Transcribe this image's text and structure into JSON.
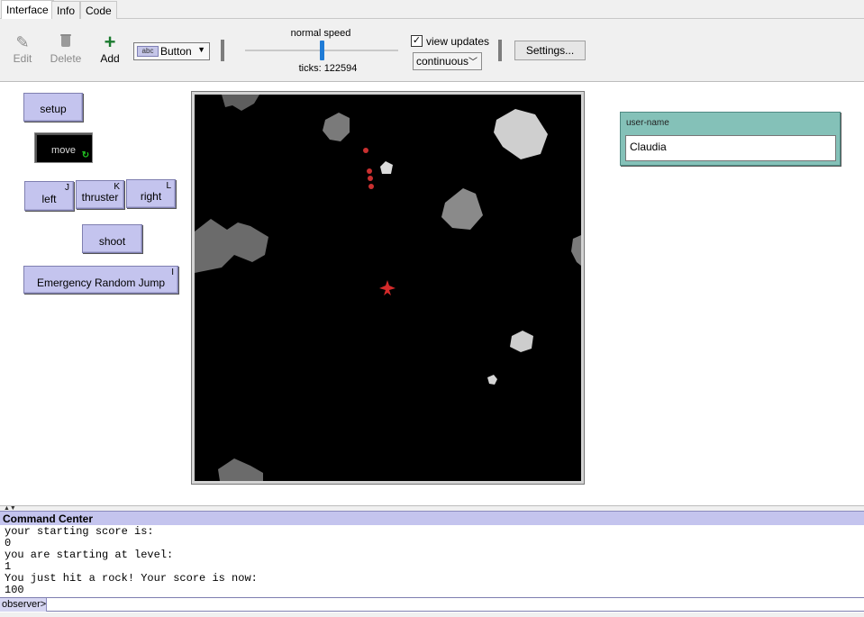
{
  "tabs": [
    "Interface",
    "Info",
    "Code"
  ],
  "toolbar": {
    "edit_label": "Edit",
    "delete_label": "Delete",
    "add_label": "Add",
    "widget_type": "Button",
    "widget_badge": "abc",
    "speed_label": "normal speed",
    "speed_value": 0.5,
    "ticks_text": "ticks: 122594",
    "view_updates_label": "view updates",
    "view_updates_checked": true,
    "update_mode": "continuous",
    "settings_label": "Settings..."
  },
  "buttons": {
    "setup": {
      "label": "setup"
    },
    "move": {
      "label": "move",
      "forever": true
    },
    "left": {
      "label": "left",
      "key": "J"
    },
    "thruster": {
      "label": "thruster",
      "key": "K"
    },
    "right": {
      "label": "right",
      "key": "L"
    },
    "shoot": {
      "label": "shoot"
    },
    "jump": {
      "label": "Emergency Random Jump",
      "key": "I"
    }
  },
  "input": {
    "label": "user-name",
    "value": "Claudia"
  },
  "command_center": {
    "title": "Command Center",
    "output": [
      "your starting score is:",
      "0",
      "you are starting at level:",
      "1",
      "You just hit a rock! Your score is now:",
      "100"
    ],
    "prompt": "observer>",
    "input_value": ""
  },
  "colors": {
    "button_bg": "#c4c4ee",
    "input_bg": "#84c1b8",
    "ship": "#d42a2a",
    "bullet": "#c93030",
    "rock_dark": "#6e6e6e",
    "rock_light": "#c8c8c8"
  }
}
